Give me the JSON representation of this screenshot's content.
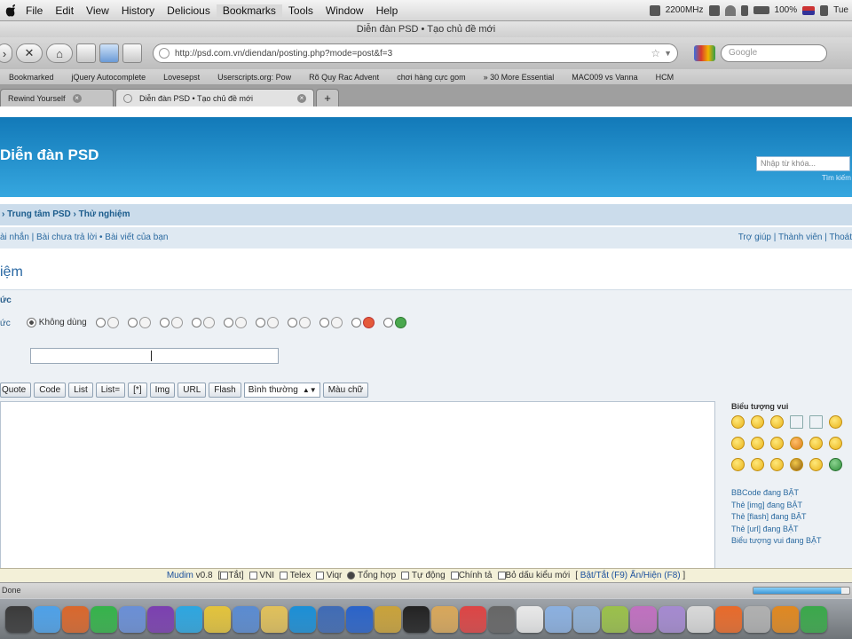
{
  "menubar": {
    "items": [
      "File",
      "Edit",
      "View",
      "History",
      "Delicious",
      "Bookmarks",
      "Tools",
      "Window",
      "Help"
    ],
    "active_index": 5,
    "speed": "2200MHz",
    "battery": "100%",
    "clock": "Tue"
  },
  "window": {
    "title": "Diễn đàn PSD • Tạo chủ đề mới"
  },
  "toolbar": {
    "url": "http://psd.com.vn/diendan/posting.php?mode=post&f=3",
    "search_placeholder": "Google"
  },
  "bookmarks": [
    "Bookmarked",
    "jQuery Autocomplete",
    "Lovesepst",
    "Userscripts.org: Pow",
    "Rõ Quy Rac Advent",
    "chơi hàng cực gom",
    "» 30 More Essential",
    "MAC009 vs Vanna",
    "HCM"
  ],
  "tabs": [
    {
      "label": "Rewind Yourself",
      "active": false
    },
    {
      "label": "Diễn đàn PSD • Tạo chủ đề mới",
      "active": true
    }
  ],
  "site": {
    "title": "Diễn đàn PSD",
    "search_placeholder": "Nhập từ khóa...",
    "search_link": "Tìm kiếm",
    "breadcrumb": "› Trung tâm PSD › Thử nghiệm",
    "subnav_left": "ài nhắn | Bài chưa trả lời • Bài viết của bạn",
    "subnav_right": "Trợ giúp | Thành viên | Thoát",
    "heading": "iệm",
    "label_message": "ức",
    "label_icon": "ức",
    "no_icon_label": "Không dùng",
    "post_icons": [
      "heart",
      "star",
      "recycle",
      "love",
      "chat",
      "question",
      "warning",
      "info",
      "red",
      "green"
    ],
    "bbcode_buttons": [
      "Quote",
      "Code",
      "List",
      "List=",
      "[*]",
      "Img",
      "URL",
      "Flash"
    ],
    "font_size_selected": "Bình thường",
    "color_button": "Màu chữ",
    "smilies_title": "Biểu tượng vui",
    "smilies": [
      "face",
      "face",
      "face",
      "box",
      "box",
      "face",
      "face",
      "face",
      "face",
      "angry",
      "face",
      "face",
      "face",
      "face",
      "face",
      "dark",
      "face",
      "green"
    ],
    "help_links": [
      "BBCode đang BẬT",
      "Thẻ [img] đang BẬT",
      "Thẻ [flash] đang BẬT",
      "Thẻ [url] đang BẬT",
      "Biểu tượng vui đang BẬT"
    ]
  },
  "ime": {
    "text_name": "Mudim",
    "version": "v0.8",
    "modes": [
      "Tắt",
      "VNI",
      "Telex",
      "Viqr",
      "Tổng hợp",
      "Tự động"
    ],
    "selected_mode": "Tổng hợp",
    "spell_check": "Chính tả",
    "accent_rule": "Bỏ dấu kiểu mới",
    "toggle_hint": "Bật/Tắt (F9) Ẩn/Hiện (F8)"
  },
  "statusbar": {
    "text": "Done",
    "progress": 0.92
  },
  "dock_colors": [
    "#3a3a3a",
    "#4ea1e8",
    "#d9672c",
    "#35b34a",
    "#6a8fd6",
    "#7b3fb0",
    "#2da6e0",
    "#e3c33b",
    "#5a8bd1",
    "#e0c05a",
    "#1b8fd6",
    "#3f6bb5",
    "#2a63c9",
    "#c9a23a",
    "#222222",
    "#d8a75a",
    "#dd4444",
    "#666666",
    "#e8e8e8",
    "#8bb0e0",
    "#8fb0d6",
    "#9ac04a",
    "#c070c0",
    "#a58ad0",
    "#d8d8d8",
    "#e86a2a",
    "#b0b0b0",
    "#e08820",
    "#3aa84a"
  ],
  "colors": {
    "banner": "#1d8acb",
    "link": "#2b6aa0"
  }
}
